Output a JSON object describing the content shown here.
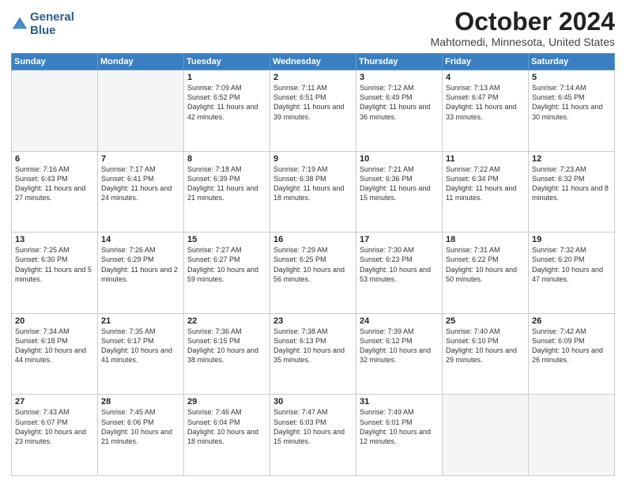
{
  "header": {
    "logo_line1": "General",
    "logo_line2": "Blue",
    "month": "October 2024",
    "location": "Mahtomedi, Minnesota, United States"
  },
  "days_of_week": [
    "Sunday",
    "Monday",
    "Tuesday",
    "Wednesday",
    "Thursday",
    "Friday",
    "Saturday"
  ],
  "weeks": [
    [
      {
        "day": "",
        "sunrise": "",
        "sunset": "",
        "daylight": ""
      },
      {
        "day": "",
        "sunrise": "",
        "sunset": "",
        "daylight": ""
      },
      {
        "day": "1",
        "sunrise": "Sunrise: 7:09 AM",
        "sunset": "Sunset: 6:52 PM",
        "daylight": "Daylight: 11 hours and 42 minutes."
      },
      {
        "day": "2",
        "sunrise": "Sunrise: 7:11 AM",
        "sunset": "Sunset: 6:51 PM",
        "daylight": "Daylight: 11 hours and 39 minutes."
      },
      {
        "day": "3",
        "sunrise": "Sunrise: 7:12 AM",
        "sunset": "Sunset: 6:49 PM",
        "daylight": "Daylight: 11 hours and 36 minutes."
      },
      {
        "day": "4",
        "sunrise": "Sunrise: 7:13 AM",
        "sunset": "Sunset: 6:47 PM",
        "daylight": "Daylight: 11 hours and 33 minutes."
      },
      {
        "day": "5",
        "sunrise": "Sunrise: 7:14 AM",
        "sunset": "Sunset: 6:45 PM",
        "daylight": "Daylight: 11 hours and 30 minutes."
      }
    ],
    [
      {
        "day": "6",
        "sunrise": "Sunrise: 7:16 AM",
        "sunset": "Sunset: 6:43 PM",
        "daylight": "Daylight: 11 hours and 27 minutes."
      },
      {
        "day": "7",
        "sunrise": "Sunrise: 7:17 AM",
        "sunset": "Sunset: 6:41 PM",
        "daylight": "Daylight: 11 hours and 24 minutes."
      },
      {
        "day": "8",
        "sunrise": "Sunrise: 7:18 AM",
        "sunset": "Sunset: 6:39 PM",
        "daylight": "Daylight: 11 hours and 21 minutes."
      },
      {
        "day": "9",
        "sunrise": "Sunrise: 7:19 AM",
        "sunset": "Sunset: 6:38 PM",
        "daylight": "Daylight: 11 hours and 18 minutes."
      },
      {
        "day": "10",
        "sunrise": "Sunrise: 7:21 AM",
        "sunset": "Sunset: 6:36 PM",
        "daylight": "Daylight: 11 hours and 15 minutes."
      },
      {
        "day": "11",
        "sunrise": "Sunrise: 7:22 AM",
        "sunset": "Sunset: 6:34 PM",
        "daylight": "Daylight: 11 hours and 11 minutes."
      },
      {
        "day": "12",
        "sunrise": "Sunrise: 7:23 AM",
        "sunset": "Sunset: 6:32 PM",
        "daylight": "Daylight: 11 hours and 8 minutes."
      }
    ],
    [
      {
        "day": "13",
        "sunrise": "Sunrise: 7:25 AM",
        "sunset": "Sunset: 6:30 PM",
        "daylight": "Daylight: 11 hours and 5 minutes."
      },
      {
        "day": "14",
        "sunrise": "Sunrise: 7:26 AM",
        "sunset": "Sunset: 6:29 PM",
        "daylight": "Daylight: 11 hours and 2 minutes."
      },
      {
        "day": "15",
        "sunrise": "Sunrise: 7:27 AM",
        "sunset": "Sunset: 6:27 PM",
        "daylight": "Daylight: 10 hours and 59 minutes."
      },
      {
        "day": "16",
        "sunrise": "Sunrise: 7:29 AM",
        "sunset": "Sunset: 6:25 PM",
        "daylight": "Daylight: 10 hours and 56 minutes."
      },
      {
        "day": "17",
        "sunrise": "Sunrise: 7:30 AM",
        "sunset": "Sunset: 6:23 PM",
        "daylight": "Daylight: 10 hours and 53 minutes."
      },
      {
        "day": "18",
        "sunrise": "Sunrise: 7:31 AM",
        "sunset": "Sunset: 6:22 PM",
        "daylight": "Daylight: 10 hours and 50 minutes."
      },
      {
        "day": "19",
        "sunrise": "Sunrise: 7:32 AM",
        "sunset": "Sunset: 6:20 PM",
        "daylight": "Daylight: 10 hours and 47 minutes."
      }
    ],
    [
      {
        "day": "20",
        "sunrise": "Sunrise: 7:34 AM",
        "sunset": "Sunset: 6:18 PM",
        "daylight": "Daylight: 10 hours and 44 minutes."
      },
      {
        "day": "21",
        "sunrise": "Sunrise: 7:35 AM",
        "sunset": "Sunset: 6:17 PM",
        "daylight": "Daylight: 10 hours and 41 minutes."
      },
      {
        "day": "22",
        "sunrise": "Sunrise: 7:36 AM",
        "sunset": "Sunset: 6:15 PM",
        "daylight": "Daylight: 10 hours and 38 minutes."
      },
      {
        "day": "23",
        "sunrise": "Sunrise: 7:38 AM",
        "sunset": "Sunset: 6:13 PM",
        "daylight": "Daylight: 10 hours and 35 minutes."
      },
      {
        "day": "24",
        "sunrise": "Sunrise: 7:39 AM",
        "sunset": "Sunset: 6:12 PM",
        "daylight": "Daylight: 10 hours and 32 minutes."
      },
      {
        "day": "25",
        "sunrise": "Sunrise: 7:40 AM",
        "sunset": "Sunset: 6:10 PM",
        "daylight": "Daylight: 10 hours and 29 minutes."
      },
      {
        "day": "26",
        "sunrise": "Sunrise: 7:42 AM",
        "sunset": "Sunset: 6:09 PM",
        "daylight": "Daylight: 10 hours and 26 minutes."
      }
    ],
    [
      {
        "day": "27",
        "sunrise": "Sunrise: 7:43 AM",
        "sunset": "Sunset: 6:07 PM",
        "daylight": "Daylight: 10 hours and 23 minutes."
      },
      {
        "day": "28",
        "sunrise": "Sunrise: 7:45 AM",
        "sunset": "Sunset: 6:06 PM",
        "daylight": "Daylight: 10 hours and 21 minutes."
      },
      {
        "day": "29",
        "sunrise": "Sunrise: 7:46 AM",
        "sunset": "Sunset: 6:04 PM",
        "daylight": "Daylight: 10 hours and 18 minutes."
      },
      {
        "day": "30",
        "sunrise": "Sunrise: 7:47 AM",
        "sunset": "Sunset: 6:03 PM",
        "daylight": "Daylight: 10 hours and 15 minutes."
      },
      {
        "day": "31",
        "sunrise": "Sunrise: 7:49 AM",
        "sunset": "Sunset: 6:01 PM",
        "daylight": "Daylight: 10 hours and 12 minutes."
      },
      {
        "day": "",
        "sunrise": "",
        "sunset": "",
        "daylight": ""
      },
      {
        "day": "",
        "sunrise": "",
        "sunset": "",
        "daylight": ""
      }
    ]
  ]
}
